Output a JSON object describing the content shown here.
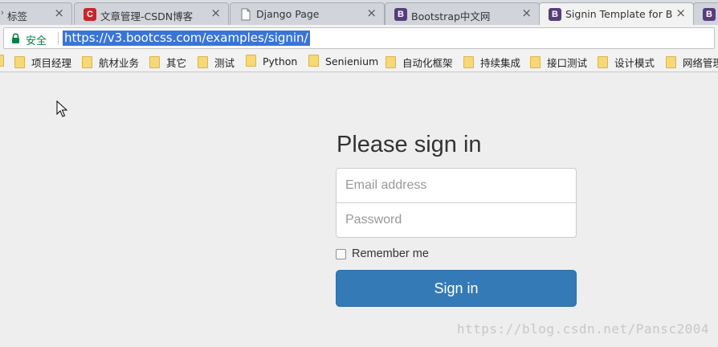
{
  "tabs": [
    {
      "title": "标签",
      "icon": "arrow-icon",
      "active": false
    },
    {
      "title": "文章管理-CSDN博客",
      "icon": "csdn-icon",
      "active": false
    },
    {
      "title": "Django Page",
      "icon": "page-icon",
      "active": false
    },
    {
      "title": "Bootstrap中文网",
      "icon": "bootstrap-icon",
      "active": false
    },
    {
      "title": "Signin Template for Bo",
      "icon": "bootstrap-icon",
      "active": true
    }
  ],
  "tab_close": "×",
  "tab_icon_letters": {
    "csdn": "C",
    "bootstrap": "B"
  },
  "address_bar": {
    "secure_label": "安全",
    "url": "https://v3.bootcss.com/examples/signin/"
  },
  "bookmarks": [
    {
      "label": "项目经理"
    },
    {
      "label": "航材业务"
    },
    {
      "label": "其它"
    },
    {
      "label": "测试"
    },
    {
      "label": "Python"
    },
    {
      "label": "Senienium"
    },
    {
      "label": "自动化框架"
    },
    {
      "label": "持续集成"
    },
    {
      "label": "接口测试"
    },
    {
      "label": "设计模式"
    },
    {
      "label": "网络管理"
    }
  ],
  "form": {
    "heading": "Please sign in",
    "email_placeholder": "Email address",
    "password_placeholder": "Password",
    "remember_label": "Remember me",
    "submit_label": "Sign in"
  },
  "watermark": "https://blog.csdn.net/Pansc2004",
  "colors": {
    "primary_button": "#337ab7",
    "url_selection": "#3875d7",
    "secure_green": "#0b8043",
    "csdn_red": "#c9262b",
    "bootstrap_purple": "#563d7c"
  }
}
